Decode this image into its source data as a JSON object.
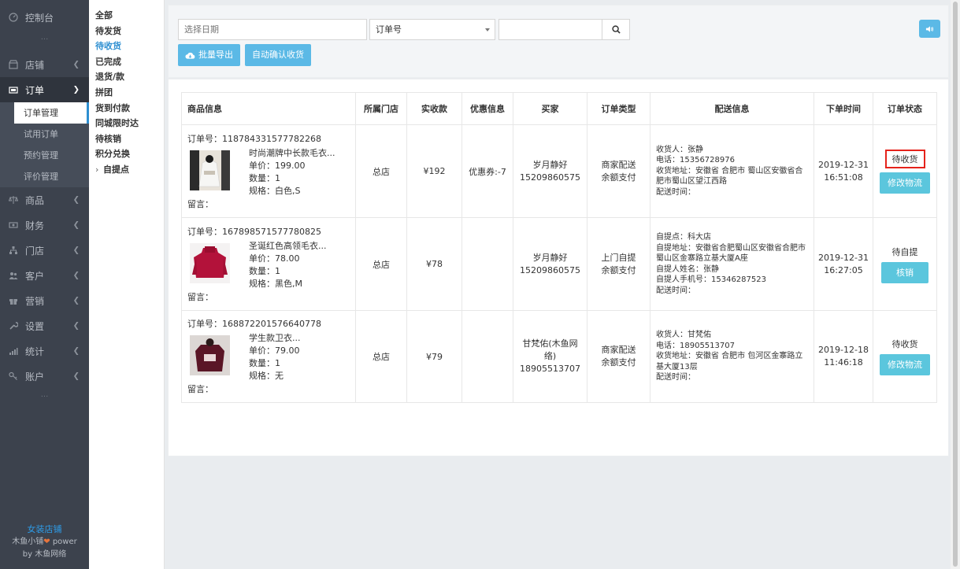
{
  "nav": {
    "items": [
      {
        "label": "控制台",
        "icon": "dashboard-icon"
      },
      {
        "label": "店铺",
        "icon": "store-icon"
      },
      {
        "label": "订单",
        "icon": "order-icon"
      },
      {
        "label": "商品",
        "icon": "scale-icon"
      },
      {
        "label": "财务",
        "icon": "finance-icon"
      },
      {
        "label": "门店",
        "icon": "branch-icon"
      },
      {
        "label": "客户",
        "icon": "users-icon"
      },
      {
        "label": "营销",
        "icon": "gift-icon"
      },
      {
        "label": "设置",
        "icon": "wrench-icon"
      },
      {
        "label": "统计",
        "icon": "stats-icon"
      },
      {
        "label": "账户",
        "icon": "key-icon"
      }
    ],
    "order_sub": [
      "订单管理",
      "试用订单",
      "预约管理",
      "评价管理"
    ],
    "dots": "···",
    "footer": {
      "shop": "女装店铺",
      "power_prefix": "木鱼小铺",
      "power_suffix": " power",
      "by": "by 木鱼网络"
    }
  },
  "submenu": [
    "全部",
    "待发货",
    "待收货",
    "已完成",
    "退货/款",
    "拼团",
    "货到付款",
    "同城限时达",
    "待核销",
    "积分兑换",
    "自提点"
  ],
  "toolbar": {
    "date_placeholder": "选择日期",
    "select_value": "订单号",
    "export_label": "批量导出",
    "confirm_label": "自动确认收货"
  },
  "table": {
    "headers": [
      "商品信息",
      "所属门店",
      "实收款",
      "优惠信息",
      "买家",
      "订单类型",
      "配送信息",
      "下单时间",
      "订单状态"
    ],
    "rows": [
      {
        "order_no": "订单号：118784331577782268",
        "name": "时尚潮牌中长款毛衣...",
        "price": "单价：199.00",
        "qty": "数量：1",
        "spec": "规格：白色,S",
        "memo": "留言：",
        "store": "总店",
        "paid": "¥192",
        "discount": "优惠券:-7",
        "buyer_name": "岁月静好",
        "buyer_phone": "15209860575",
        "type1": "商家配送",
        "type2": "余额支付",
        "ship": [
          "收货人：张静",
          "电话：15356728976",
          "收货地址：安徽省 合肥市 蜀山区安徽省合肥市蜀山区望江西路",
          "配送时间："
        ],
        "date": "2019-12-31",
        "time": "16:51:08",
        "status": "待收货",
        "action": "修改物流"
      },
      {
        "order_no": "订单号：167898571577780825",
        "name": "圣诞红色高领毛衣...",
        "price": "单价：78.00",
        "qty": "数量：1",
        "spec": "规格：黑色,M",
        "memo": "留言：",
        "store": "总店",
        "paid": "¥78",
        "discount": "",
        "buyer_name": "岁月静好",
        "buyer_phone": "15209860575",
        "type1": "上门自提",
        "type2": "余额支付",
        "ship": [
          "自提点：科大店",
          "自提地址：安徽省合肥蜀山区安徽省合肥市蜀山区金寨路立基大厦A座",
          "自提人姓名：张静",
          "自提人手机号：15346287523",
          "配送时间："
        ],
        "date": "2019-12-31",
        "time": "16:27:05",
        "status": "待自提",
        "action": "核销"
      },
      {
        "order_no": "订单号：168872201576640778",
        "name": "学生款卫衣...",
        "price": "单价：79.00",
        "qty": "数量：1",
        "spec": "规格：无",
        "memo": "留言：",
        "store": "总店",
        "paid": "¥79",
        "discount": "",
        "buyer_name": "甘梵佑(木鱼网络)",
        "buyer_phone": "18905513707",
        "type1": "商家配送",
        "type2": "余额支付",
        "ship": [
          "收货人：甘梵佑",
          "电话：18905513707",
          "收货地址：安徽省 合肥市 包河区金寨路立基大厦13层",
          "配送时间："
        ],
        "date": "2019-12-18",
        "time": "11:46:18",
        "status": "待收货",
        "action": "修改物流"
      }
    ]
  },
  "colors": {
    "nav_bg": "#3c424d",
    "accent": "#5bb9e6",
    "cyan_button": "#5bc6dd",
    "status_border": "#e5231b",
    "active_link": "#2e8fd1"
  }
}
